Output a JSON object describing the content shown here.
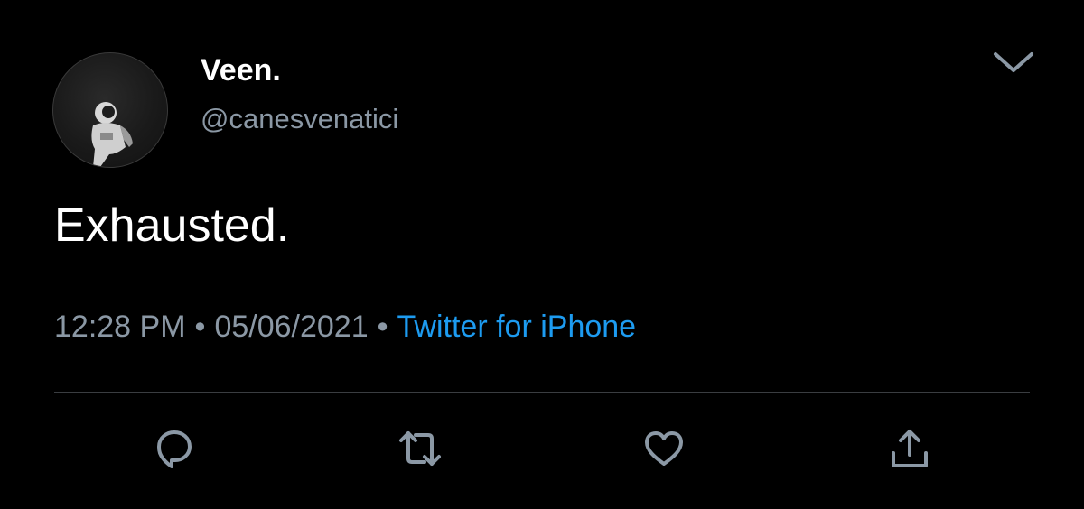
{
  "tweet": {
    "display_name": "Veen.",
    "handle": "@canesvenatici",
    "text": "Exhausted.",
    "time": "12:28 PM",
    "date": "05/06/2021",
    "separator": "•",
    "source": "Twitter for iPhone"
  },
  "icons": {
    "more": "chevron-down-icon",
    "reply": "reply-icon",
    "retweet": "retweet-icon",
    "like": "heart-icon",
    "share": "share-icon"
  },
  "colors": {
    "background": "#000000",
    "primary_text": "#ffffff",
    "secondary_text": "#8b98a5",
    "link": "#1d9bf0",
    "divider": "#3a3d41"
  }
}
